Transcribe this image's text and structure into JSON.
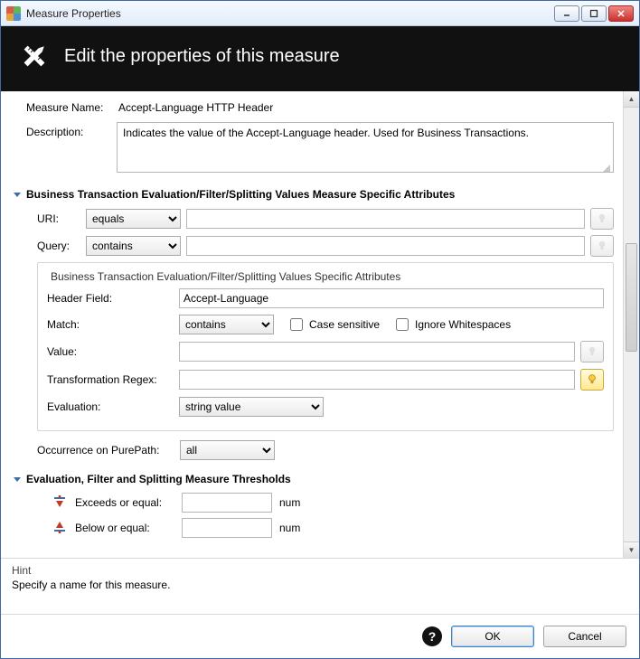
{
  "window": {
    "title": "Measure Properties"
  },
  "header": {
    "title": "Edit the properties of this measure"
  },
  "form": {
    "measure_name_label": "Measure Name:",
    "measure_name_value": "Accept-Language HTTP Header",
    "description_label": "Description:",
    "description_value": "Indicates the value of the Accept-Language header. Used for Business Transactions."
  },
  "sections": {
    "bts_attrs": "Business Transaction Evaluation/Filter/Splitting Values Measure Specific Attributes",
    "thresholds": "Evaluation, Filter and Splitting Measure Thresholds"
  },
  "uri": {
    "label": "URI:",
    "op": "equals",
    "value": ""
  },
  "query": {
    "label": "Query:",
    "op": "contains",
    "value": ""
  },
  "fieldset": {
    "legend": "Business Transaction Evaluation/Filter/Splitting Values Specific Attributes",
    "header_field_label": "Header Field:",
    "header_field_value": "Accept-Language",
    "match_label": "Match:",
    "match_value": "contains",
    "case_sensitive_label": "Case sensitive",
    "ignore_ws_label": "Ignore Whitespaces",
    "value_label": "Value:",
    "value_value": "",
    "regex_label": "Transformation Regex:",
    "regex_value": "",
    "evaluation_label": "Evaluation:",
    "evaluation_value": "string value"
  },
  "occurrence": {
    "label": "Occurrence on PurePath:",
    "value": "all"
  },
  "thresholds": {
    "exceeds_label": "Exceeds or equal:",
    "below_label": "Below or equal:",
    "unit": "num",
    "exceeds_value": "",
    "below_value": ""
  },
  "hint": {
    "title": "Hint",
    "text": "Specify a name for this measure."
  },
  "footer": {
    "ok": "OK",
    "cancel": "Cancel"
  }
}
